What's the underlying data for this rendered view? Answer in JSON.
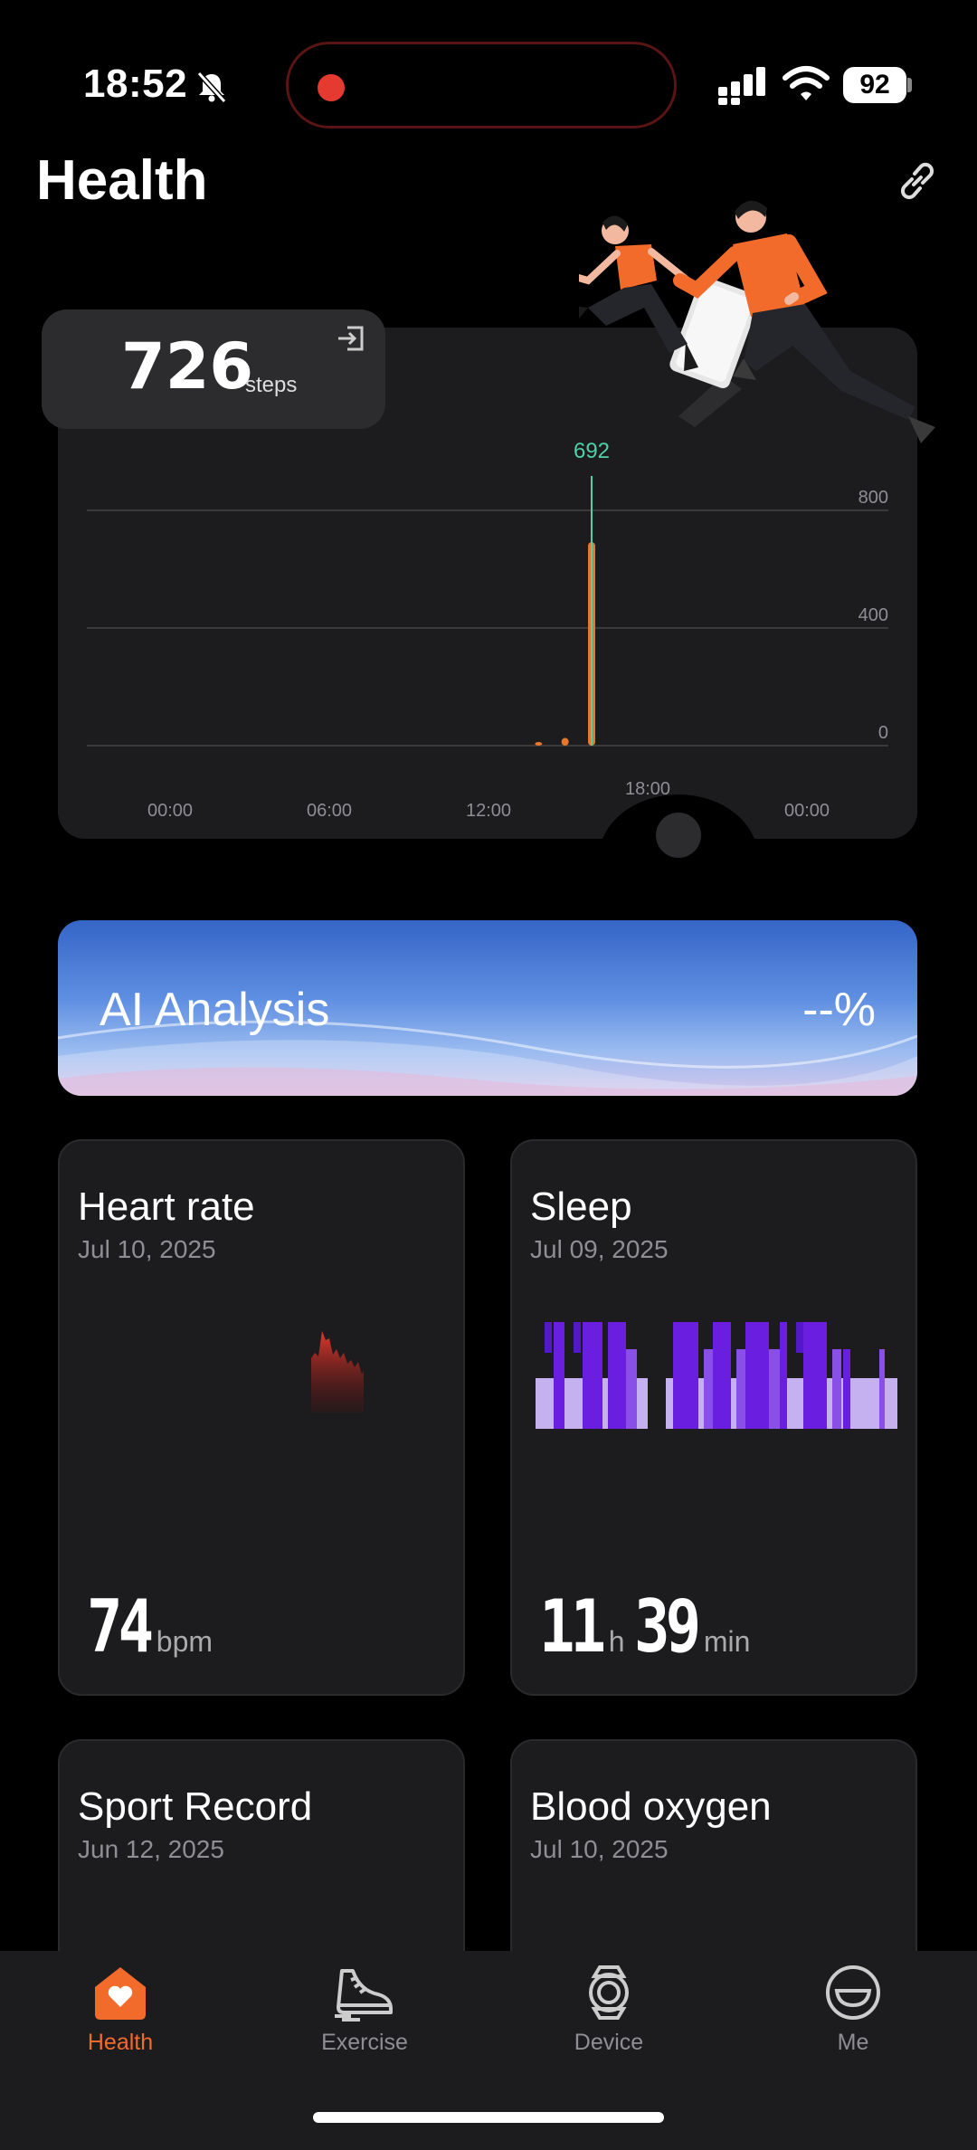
{
  "status_bar": {
    "time": "18:52",
    "battery": "92"
  },
  "header": {
    "title": "Health"
  },
  "steps": {
    "value": "726",
    "unit": "steps",
    "peak_label": "692",
    "y_ticks": [
      "800",
      "400",
      "0"
    ],
    "x_ticks": [
      "00:00",
      "06:00",
      "12:00",
      "18:00",
      "00:00"
    ]
  },
  "chart_data": {
    "type": "bar",
    "title": "",
    "xlabel": "",
    "ylabel": "",
    "x": [
      "16:00",
      "17:00",
      "18:00"
    ],
    "values": [
      8,
      26,
      692
    ],
    "ylim": [
      0,
      800
    ],
    "yticks": [
      0,
      400,
      800
    ],
    "xticks": [
      "00:00",
      "06:00",
      "12:00",
      "18:00",
      "00:00"
    ],
    "annotations": [
      "692"
    ],
    "colors": {
      "bar": "#e8772e",
      "marker": "#4fd1a5"
    }
  },
  "ai_analysis": {
    "title": "AI Analysis",
    "value": "--%"
  },
  "tiles": {
    "heart_rate": {
      "title": "Heart rate",
      "date": "Jul 10, 2025",
      "value": "74",
      "unit": "bpm"
    },
    "sleep": {
      "title": "Sleep",
      "date": "Jul 09, 2025",
      "hours": "11",
      "h_unit": "h",
      "minutes": "39",
      "min_unit": "min"
    },
    "sport_record": {
      "title": "Sport Record",
      "date": "Jun 12, 2025"
    },
    "blood_oxygen": {
      "title": "Blood oxygen",
      "date": "Jul 10, 2025"
    }
  },
  "nav": {
    "items": [
      {
        "label": "Health",
        "icon": "heart-home-icon",
        "active": true
      },
      {
        "label": "Exercise",
        "icon": "sneaker-icon",
        "active": false
      },
      {
        "label": "Device",
        "icon": "watch-icon",
        "active": false
      },
      {
        "label": "Me",
        "icon": "smile-face-icon",
        "active": false
      }
    ]
  },
  "colors": {
    "accent": "#f26b2a",
    "card": "#1c1c1e",
    "muted": "#8e8e93"
  }
}
